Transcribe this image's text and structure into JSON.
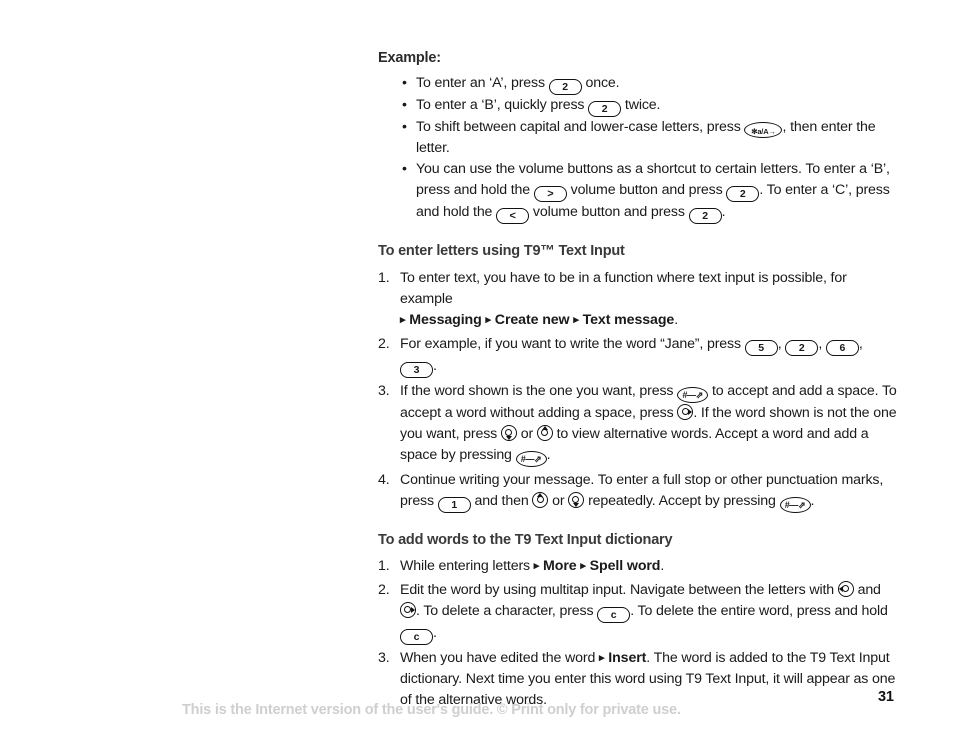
{
  "document": {
    "page_number": "31",
    "footer_note": "This is the Internet version of the user's guide. © Print only for private use."
  },
  "example": {
    "heading": "Example:",
    "bullet_char": "•",
    "items": [
      {
        "pre": "To enter an ‘A’, press ",
        "key1": "2",
        "post": " once."
      },
      {
        "pre": "To enter a ‘B’, quickly press ",
        "key1": "2",
        "post": " twice."
      },
      {
        "pre": "To shift between capital and lower-case letters, press ",
        "key1": "✻a/A→",
        "post": ", then enter the letter."
      },
      {
        "pre": "You can use the volume buttons as a shortcut to certain letters. To enter a ‘B’, press and hold the ",
        "key1": ">",
        "mid1": " volume button and press ",
        "key2": "2",
        "mid2": ". To enter a ‘C’, press and hold the ",
        "key3": "<",
        "mid3": " volume button and press ",
        "key4": "2",
        "post": "."
      }
    ]
  },
  "section_t9": {
    "heading": "To enter letters using T9™ Text Input",
    "steps": [
      {
        "num": "1.",
        "t1": "To enter text, you have to be in a function where text input is possible, for example ",
        "path": "Messaging ▸ Create new ▸ Text message",
        "path_arrow": "▸",
        "path_parts": [
          "Messaging",
          "Create new",
          "Text message"
        ],
        "t2": "."
      },
      {
        "num": "2.",
        "t1": "For example, if you want to write the word “Jane”, press ",
        "key1": "5",
        "t2": ", ",
        "key2": "2",
        "t3": ", ",
        "key3": "6",
        "t4": ", ",
        "key4": "3",
        "t5": "."
      },
      {
        "num": "3.",
        "t1": "If the word shown is the one you want, press ",
        "key1": "#—⇗",
        "t2": " to accept and add a space. To accept a word without adding a space, press ",
        "nav1": "nav-right",
        "t3": ". If the word shown is not the one you want, press ",
        "nav2": "nav-down",
        "t4": " or ",
        "nav3": "nav-up",
        "t5": " to view alternative words. Accept a word and add a space by pressing ",
        "key2": "#—⇗",
        "t6": "."
      },
      {
        "num": "4.",
        "t1": "Continue writing your message. To enter a full stop or other punctuation marks, press ",
        "key1": "1",
        "t2": " and then ",
        "nav1": "nav-up",
        "t3": " or ",
        "nav2": "nav-down",
        "t4": " repeatedly. Accept by pressing ",
        "key2": "#—⇗",
        "t5": "."
      }
    ]
  },
  "section_dict": {
    "heading": "To add words to the T9 Text Input dictionary",
    "steps": [
      {
        "num": "1.",
        "t1": "While entering letters ",
        "path_arrow": "▸",
        "path_parts": [
          "More",
          "Spell word"
        ],
        "t2": "."
      },
      {
        "num": "2.",
        "t1": "Edit the word by using multitap input. Navigate between the letters with ",
        "nav1": "nav-left",
        "t2": " and ",
        "nav2": "nav-right",
        "t3": ". To delete a character, press ",
        "key1": "c",
        "t4": ". To delete the entire word, press and hold ",
        "key2": "c",
        "t5": "."
      },
      {
        "num": "3.",
        "t1": "When you have edited the word ",
        "path_arrow": "▸",
        "path_parts": [
          "Insert"
        ],
        "t2": ". The word is added to the T9 Text Input dictionary. Next time you enter this word using T9 Text Input, it will appear as one of the alternative words."
      }
    ]
  }
}
